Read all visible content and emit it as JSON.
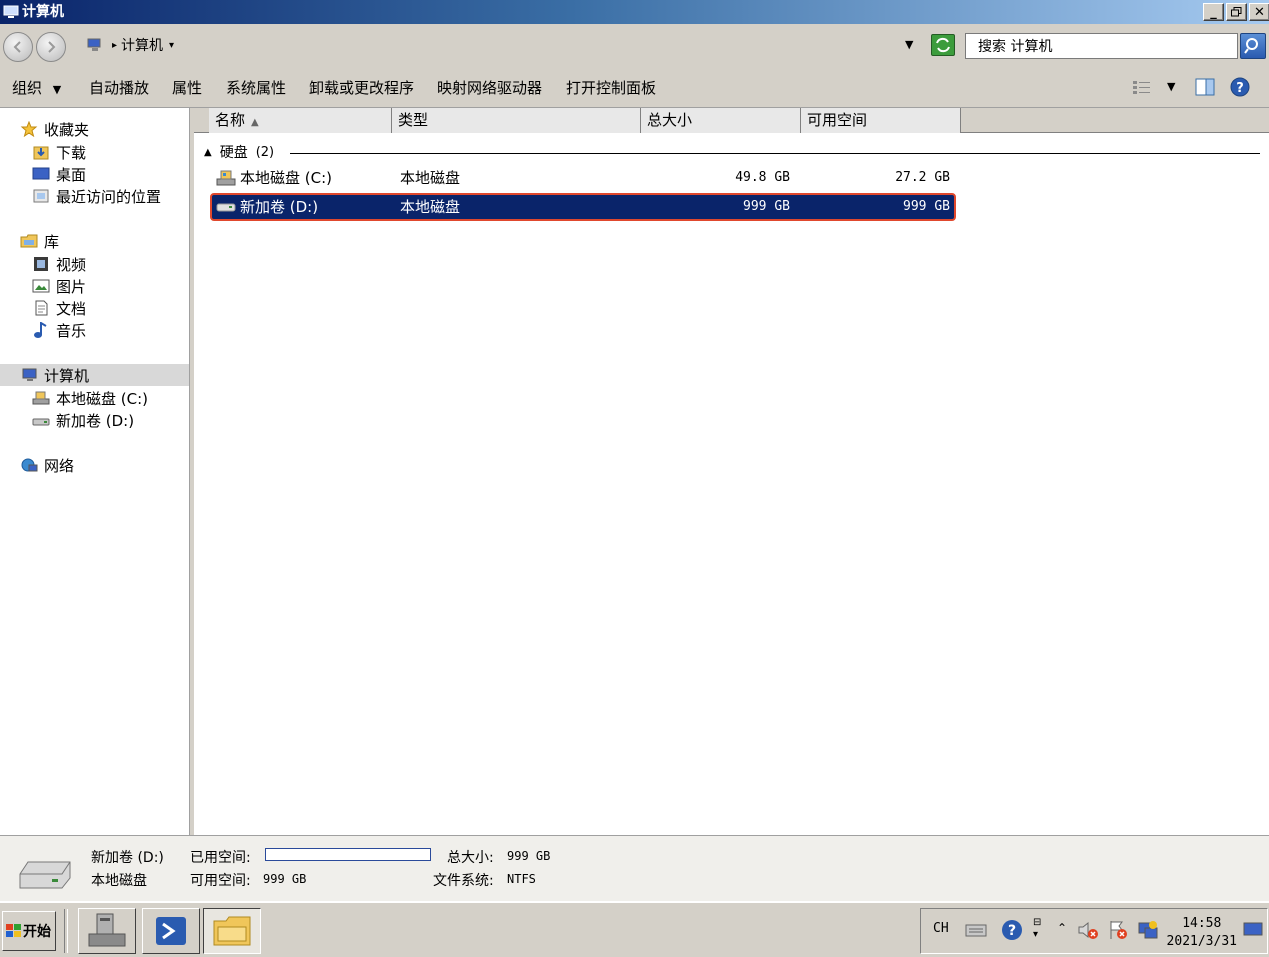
{
  "window": {
    "title": "计算机"
  },
  "address": {
    "crumb": "计算机",
    "search_placeholder": "搜索 计算机"
  },
  "toolbar": {
    "organize": "组织",
    "autoplay": "自动播放",
    "properties": "属性",
    "system_properties": "系统属性",
    "uninstall": "卸载或更改程序",
    "map_drive": "映射网络驱动器",
    "control_panel": "打开控制面板"
  },
  "nav": {
    "favorites": "收藏夹",
    "downloads": "下载",
    "desktop": "桌面",
    "recent": "最近访问的位置",
    "libraries": "库",
    "videos": "视频",
    "pictures": "图片",
    "documents": "文档",
    "music": "音乐",
    "computer": "计算机",
    "drive_c": "本地磁盘 (C:)",
    "drive_d": "新加卷 (D:)",
    "network": "网络"
  },
  "columns": {
    "name": "名称",
    "type": "类型",
    "total": "总大小",
    "free": "可用空间"
  },
  "group": {
    "label": "硬盘",
    "count": "(2)"
  },
  "drives": [
    {
      "name": "本地磁盘 (C:)",
      "type": "本地磁盘",
      "total": "49.8 GB",
      "free": "27.2 GB"
    },
    {
      "name": "新加卷 (D:)",
      "type": "本地磁盘",
      "total": "999 GB",
      "free": "999 GB"
    }
  ],
  "details": {
    "name": "新加卷 (D:)",
    "type": "本地磁盘",
    "used_label": "已用空间:",
    "free_label": "可用空间:",
    "free_value": "999 GB",
    "total_label": "总大小:",
    "total_value": "999 GB",
    "fs_label": "文件系统:",
    "fs_value": "NTFS",
    "used_fraction": 0.0
  },
  "taskbar": {
    "start": "开始",
    "lang": "CH",
    "time": "14:58",
    "date": "2021/3/31"
  },
  "colors": {
    "selection": "#0a246a",
    "selection_border": "#e0482d"
  }
}
